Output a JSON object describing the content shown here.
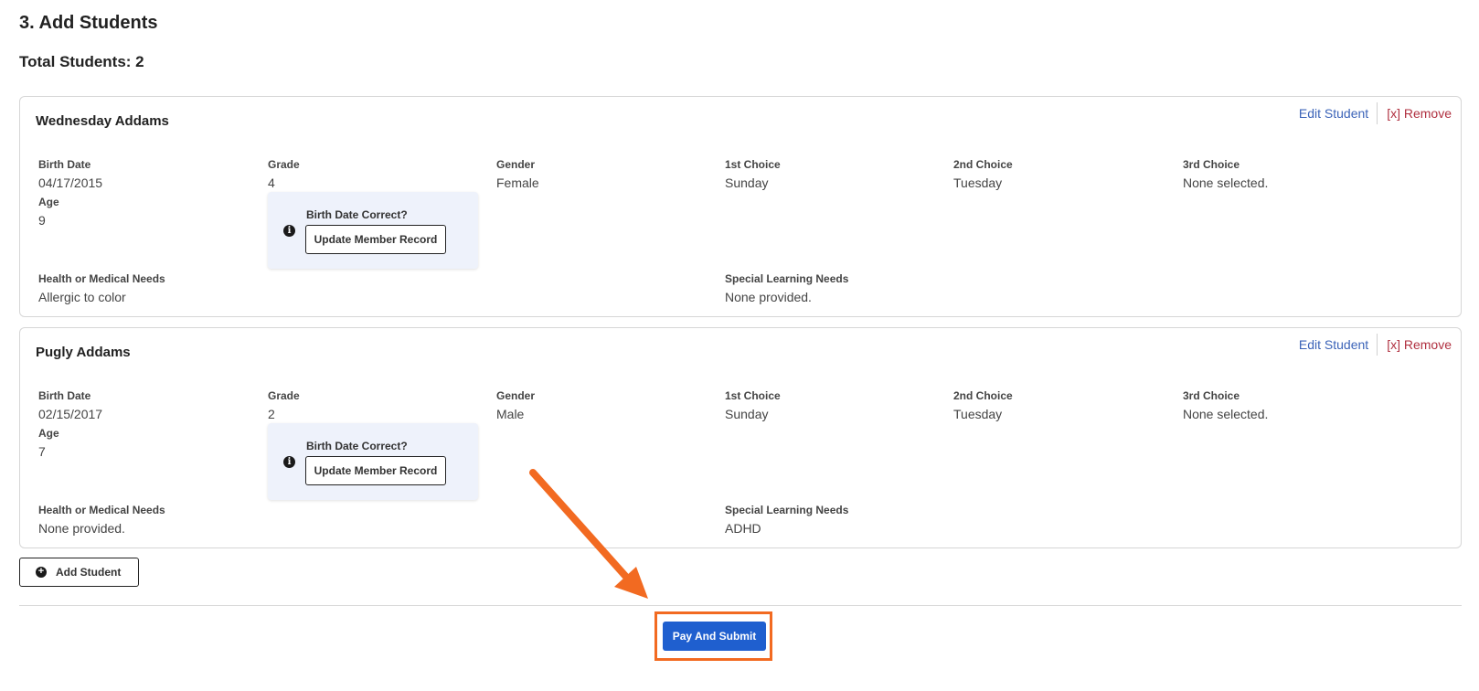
{
  "section": {
    "title": "3. Add Students",
    "total_label": "Total Students: 2"
  },
  "students": [
    {
      "name": "Wednesday Addams",
      "edit_label": "Edit Student",
      "remove_label": "[x] Remove",
      "birth_date": {
        "label": "Birth Date",
        "value": "04/17/2015"
      },
      "age": {
        "label": "Age",
        "value": "9"
      },
      "grade": {
        "label": "Grade",
        "value": "4"
      },
      "gender": {
        "label": "Gender",
        "value": "Female"
      },
      "choice1": {
        "label": "1st Choice",
        "value": "Sunday"
      },
      "choice2": {
        "label": "2nd Choice",
        "value": "Tuesday"
      },
      "choice3": {
        "label": "3rd Choice",
        "value": "None selected."
      },
      "callout": {
        "question": "Birth Date Correct?",
        "button": "Update Member Record"
      },
      "health": {
        "label": "Health or Medical Needs",
        "value": "Allergic to color"
      },
      "learning": {
        "label": "Special Learning Needs",
        "value": "None provided."
      }
    },
    {
      "name": "Pugly Addams",
      "edit_label": "Edit Student",
      "remove_label": "[x] Remove",
      "birth_date": {
        "label": "Birth Date",
        "value": "02/15/2017"
      },
      "age": {
        "label": "Age",
        "value": "7"
      },
      "grade": {
        "label": "Grade",
        "value": "2"
      },
      "gender": {
        "label": "Gender",
        "value": "Male"
      },
      "choice1": {
        "label": "1st Choice",
        "value": "Sunday"
      },
      "choice2": {
        "label": "2nd Choice",
        "value": "Tuesday"
      },
      "choice3": {
        "label": "3rd Choice",
        "value": "None selected."
      },
      "callout": {
        "question": "Birth Date Correct?",
        "button": "Update Member Record"
      },
      "health": {
        "label": "Health or Medical Needs",
        "value": "None provided."
      },
      "learning": {
        "label": "Special Learning Needs",
        "value": "ADHD"
      }
    }
  ],
  "actions": {
    "add_student": "Add Student",
    "pay_submit": "Pay And Submit"
  },
  "icons": {
    "info": "info-circle-icon",
    "add": "plus-circle-icon",
    "annotation": "arrow-icon"
  },
  "colors": {
    "accent": "#1f5fcf",
    "link": "#3b63b8",
    "remove": "#b03040",
    "annotation": "#f26a21",
    "callout_bg": "#eef2fb"
  }
}
